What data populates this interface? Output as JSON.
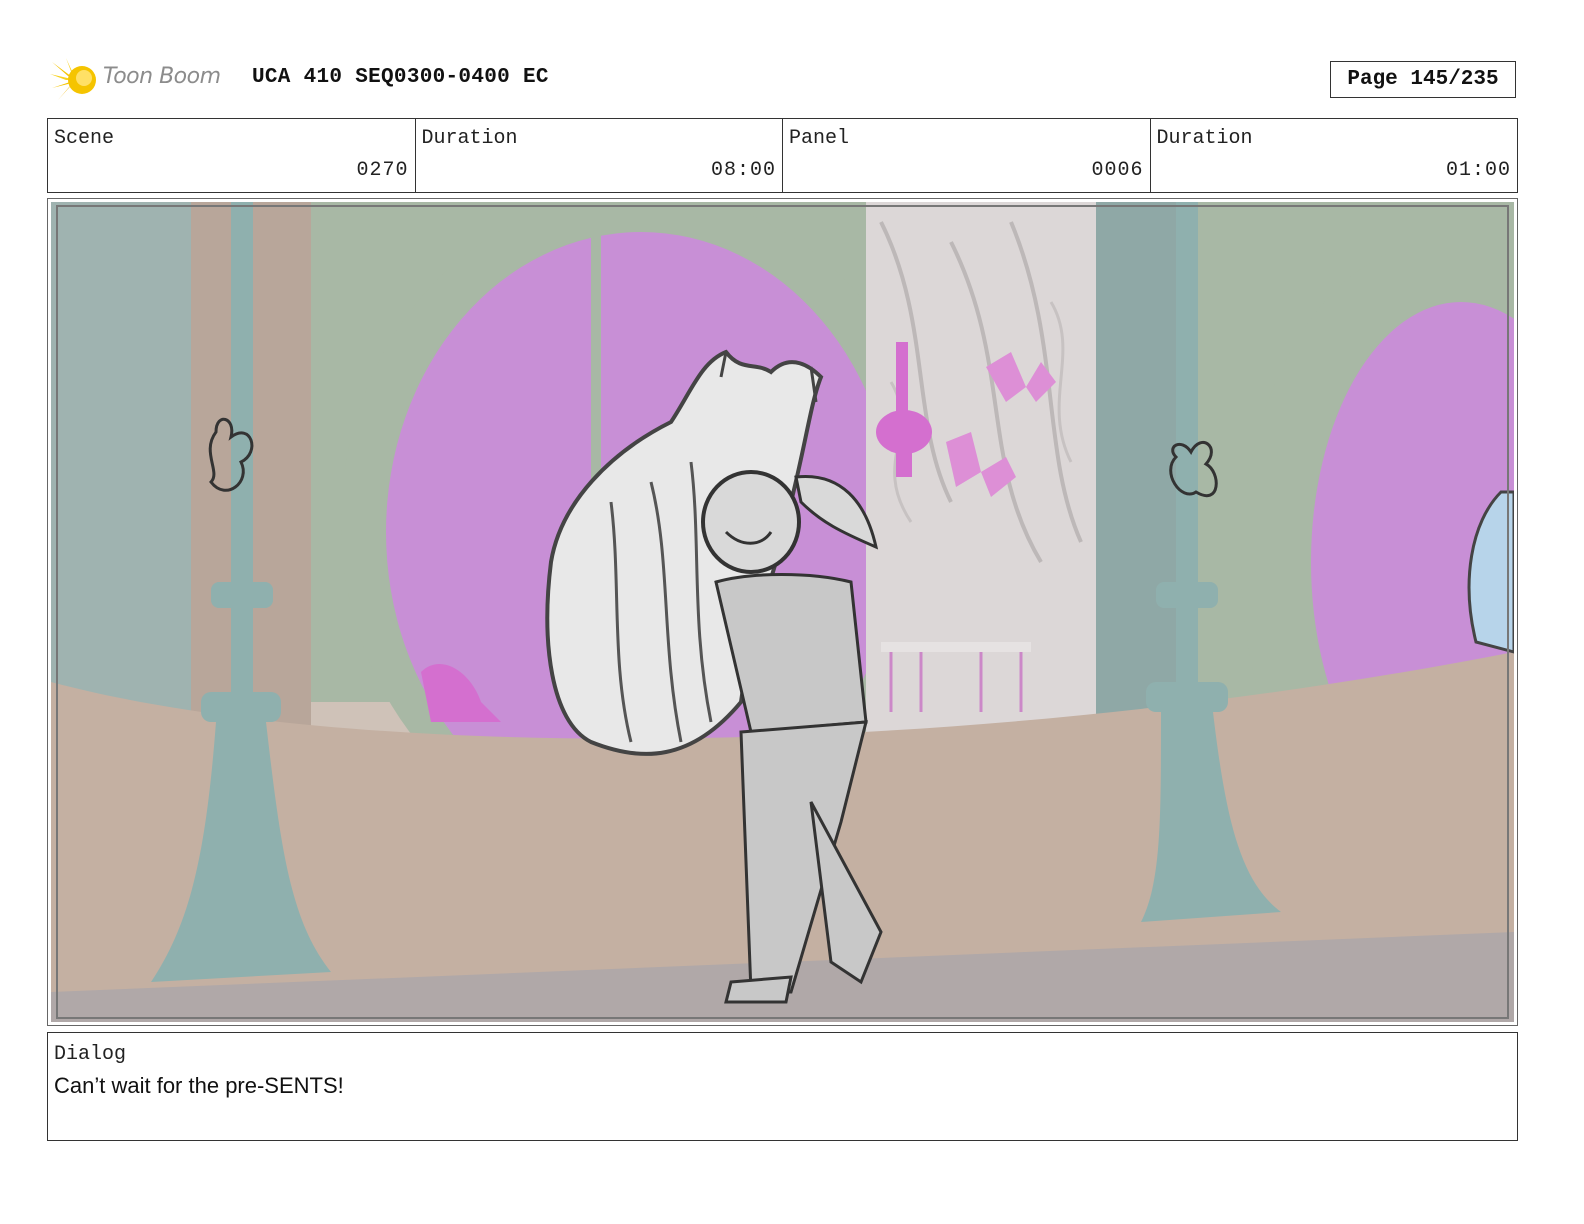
{
  "header": {
    "logo_text": "Toon Boom",
    "title": "UCA 410 SEQ0300-0400 EC",
    "page": "Page 145/235"
  },
  "info": [
    {
      "label": "Scene",
      "value": "0270"
    },
    {
      "label": "Duration",
      "value": "08:00"
    },
    {
      "label": "Panel",
      "value": "0006"
    },
    {
      "label": "Duration",
      "value": "01:00"
    }
  ],
  "dialog": {
    "label": "Dialog",
    "text": "Can’t wait for the pre-SENTS!"
  },
  "colors": {
    "logo_accent": "#f5c400",
    "window_magenta": "#c88fd6",
    "pillar_teal": "#8fb0ae",
    "wall_tan": "#c4b0a2"
  }
}
